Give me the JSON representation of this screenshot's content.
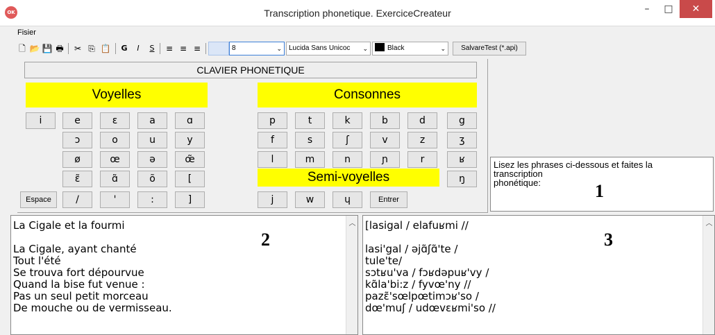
{
  "window": {
    "title": "Transcription phonetique. ExerciceCreateur",
    "app_icon_label": "OK",
    "minimize": "–",
    "maximize": "□",
    "close": "✕"
  },
  "menu": {
    "items": [
      "Fisier"
    ]
  },
  "toolbar": {
    "icons": [
      "new-file-icon",
      "open-folder-icon",
      "save-icon",
      "print-icon",
      "cut-icon",
      "copy-icon",
      "paste-icon",
      "bold-icon",
      "italic-icon",
      "underline-icon",
      "align-left-icon",
      "align-center-icon",
      "align-right-icon"
    ],
    "glyphs": {
      "new": "🗋",
      "open": "📂",
      "save": "💾",
      "print": "🖶",
      "cut": "✂",
      "copy": "⎘",
      "paste": "📋",
      "bold": "G",
      "italic": "I",
      "underline": "S",
      "align_left": "≡",
      "align_center": "≡",
      "align_right": "≡"
    },
    "font_size_value": "8",
    "font_name": "Lucida Sans Unicoc",
    "color_name": "Black",
    "save_test_label": "SalvareTest (*.api)"
  },
  "keyboard": {
    "header": "CLAVIER PHONETIQUE",
    "vowels_label": "Voyelles",
    "consonants_label": "Consonnes",
    "semivowels_label": "Semi-voyelles",
    "vowel_keys": [
      "i",
      "e",
      "ɛ",
      "a",
      "ɑ",
      "ɔ",
      "o",
      "u",
      "y",
      "ø",
      "œ",
      "ə",
      "œ̃",
      "ɛ̃",
      "ɑ̃",
      "õ",
      "[",
      "Espace",
      "/",
      "'",
      ":",
      "]"
    ],
    "consonant_keys": [
      "p",
      "t",
      "k",
      "b",
      "d",
      "g",
      "f",
      "s",
      "ʃ",
      "v",
      "z",
      "ʒ",
      "l",
      "m",
      "n",
      "ɲ",
      "r",
      "ʁ",
      "ŋ",
      "j",
      "w",
      "ɥ",
      "Entrer"
    ]
  },
  "instructions": {
    "text_line1": "Lisez les phrases ci-dessous et faites la",
    "text_line2": "transcription",
    "text_line3": "phonétique:",
    "marker": "1"
  },
  "source_text": {
    "marker": "2",
    "lines": [
      "La Cigale et la fourmi",
      "",
      "La Cigale, ayant chanté",
      "Tout l'été",
      "Se trouva fort dépourvue",
      "Quand la bise fut venue :",
      "Pas un seul petit morceau",
      "De mouche ou de vermisseau."
    ]
  },
  "transcription": {
    "marker": "3",
    "lines": [
      "[lasigal / elafuʁmi //",
      "",
      "lasi'gal / əjɑ̃ʃɑ̃'te /",
      "tule'te/",
      "sɔtʁu'va / fɔʁdəpuʁ'vy /",
      "kɑ̃la'bi:z / fyvœ'ny //",
      "pazɛ̃'sœlpœtimɔʁ'so /",
      "dœ'muʃ / udœvɛʁmi'so //"
    ]
  }
}
